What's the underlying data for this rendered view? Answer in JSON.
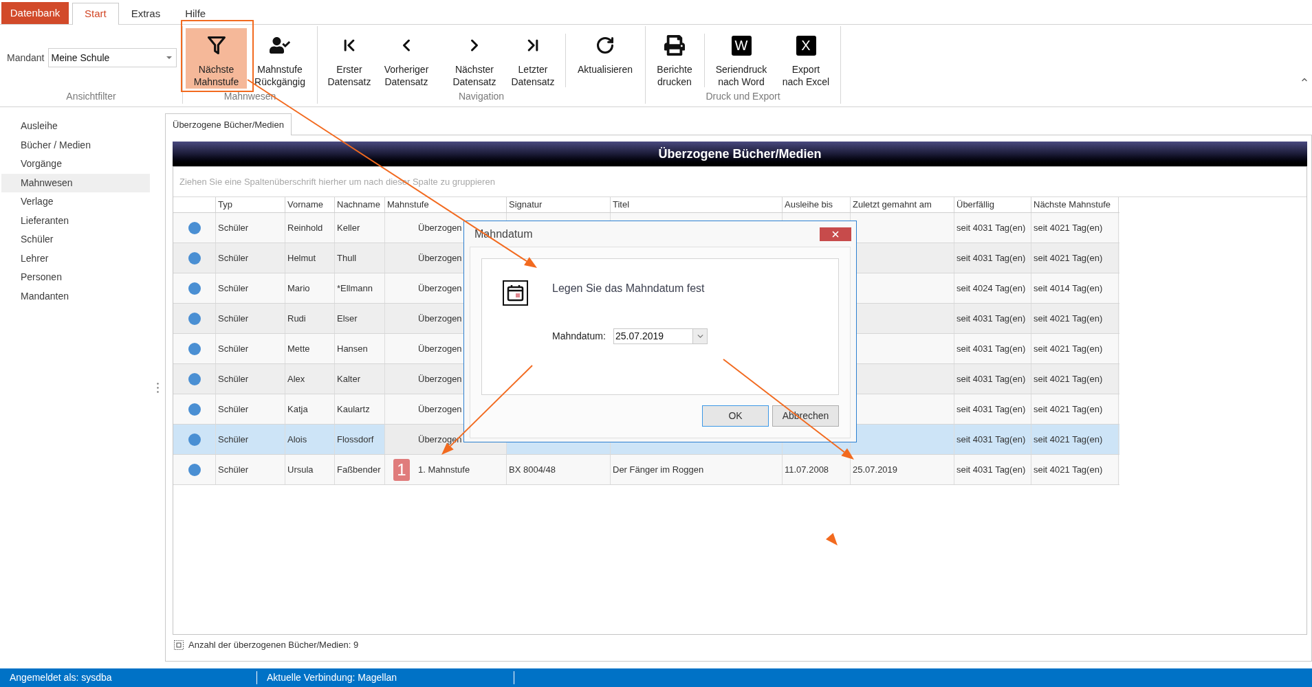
{
  "app_menu": {
    "label": "Datenbank"
  },
  "ribbon_tabs": [
    {
      "label": "Start",
      "selected": true
    },
    {
      "label": "Extras",
      "selected": false
    },
    {
      "label": "Hilfe",
      "selected": false
    }
  ],
  "ribbon_groups": [
    {
      "label": "Ansichtfilter",
      "kind": "field",
      "field": {
        "label": "Mandant",
        "value": "Meine Schule"
      }
    },
    {
      "label": "Mahnwesen",
      "kind": "buttons",
      "sections": [
        [
          {
            "lines": [
              "Nächste",
              "Mahnstufe"
            ],
            "highlighted": true
          },
          {
            "lines": [
              "Mahnstufe",
              "Rückgängig"
            ],
            "highlighted": false
          }
        ]
      ]
    },
    {
      "label": "Navigation",
      "kind": "buttons",
      "sections": [
        [
          {
            "lines": [
              "Erster",
              "Datensatz"
            ],
            "highlighted": false
          },
          {
            "lines": [
              "Vorheriger",
              "Datensatz"
            ],
            "highlighted": false
          },
          {
            "lines": [
              "Nächster",
              "Datensatz"
            ],
            "highlighted": false
          },
          {
            "lines": [
              "Letzter",
              "Datensatz"
            ],
            "highlighted": false
          }
        ],
        [
          {
            "lines": [
              "Aktualisieren"
            ],
            "highlighted": false
          }
        ]
      ]
    },
    {
      "label": "Druck und Export",
      "kind": "buttons",
      "sections": [
        [
          {
            "lines": [
              "Berichte",
              "drucken"
            ],
            "highlighted": false
          }
        ],
        [
          {
            "lines": [
              "Seriendruck",
              "nach Word"
            ],
            "highlighted": false,
            "icon_text": "W"
          },
          {
            "lines": [
              "Export",
              "nach Excel"
            ],
            "highlighted": false,
            "icon_text": "X"
          }
        ]
      ]
    }
  ],
  "sidebar": {
    "items": [
      {
        "label": "Ausleihe",
        "selected": false
      },
      {
        "label": "Bücher / Medien",
        "selected": false
      },
      {
        "label": "Vorgänge",
        "selected": false
      },
      {
        "label": "Mahnwesen",
        "selected": true
      },
      {
        "label": "Verlage",
        "selected": false
      },
      {
        "label": "Lieferanten",
        "selected": false
      },
      {
        "label": "Schüler",
        "selected": false
      },
      {
        "label": "Lehrer",
        "selected": false
      },
      {
        "label": "Personen",
        "selected": false
      },
      {
        "label": "Mandanten",
        "selected": false
      }
    ]
  },
  "content_tabs": [
    {
      "label": "Überzogene Bücher/Medien",
      "selected": true
    }
  ],
  "grid": {
    "title": "Überzogene Bücher/Medien",
    "group_hint": "Ziehen Sie eine Spaltenüberschrift hierher um nach dieser Spalte zu gruppieren",
    "columns": [
      "Typ",
      "Vorname",
      "Nachname",
      "Mahnstufe",
      "Signatur",
      "Titel",
      "Ausleihe bis",
      "Zuletzt gemahnt am",
      "Überfällig",
      "Nächste Mahnstufe"
    ],
    "rows": [
      {
        "selected": false,
        "typ": "Schüler",
        "vorname": "Reinhold",
        "nachname": "Keller",
        "mahnstufe": "Überzogen",
        "ueberfaellig": "seit 4031 Tag(en)",
        "naechste_mahnstufe": "seit 4021 Tag(en)"
      },
      {
        "selected": false,
        "typ": "Schüler",
        "vorname": "Helmut",
        "nachname": "Thull",
        "mahnstufe": "Überzogen",
        "ueberfaellig": "seit 4031 Tag(en)",
        "naechste_mahnstufe": "seit 4021 Tag(en)"
      },
      {
        "selected": false,
        "typ": "Schüler",
        "vorname": "Mario",
        "nachname": "*Ellmann",
        "mahnstufe": "Überzogen",
        "ueberfaellig": "seit 4024 Tag(en)",
        "naechste_mahnstufe": "seit 4014 Tag(en)"
      },
      {
        "selected": false,
        "typ": "Schüler",
        "vorname": "Rudi",
        "nachname": "Elser",
        "mahnstufe": "Überzogen",
        "ueberfaellig": "seit 4031 Tag(en)",
        "naechste_mahnstufe": "seit 4021 Tag(en)"
      },
      {
        "selected": false,
        "typ": "Schüler",
        "vorname": "Mette",
        "nachname": "Hansen",
        "mahnstufe": "Überzogen",
        "ueberfaellig": "seit 4031 Tag(en)",
        "naechste_mahnstufe": "seit 4021 Tag(en)"
      },
      {
        "selected": false,
        "typ": "Schüler",
        "vorname": "Alex",
        "nachname": "Kalter",
        "mahnstufe": "Überzogen",
        "ueberfaellig": "seit 4031 Tag(en)",
        "naechste_mahnstufe": "seit 4021 Tag(en)"
      },
      {
        "selected": false,
        "typ": "Schüler",
        "vorname": "Katja",
        "nachname": "Kaulartz",
        "mahnstufe": "Überzogen",
        "ueberfaellig": "seit 4031 Tag(en)",
        "naechste_mahnstufe": "seit 4021 Tag(en)"
      },
      {
        "selected": true,
        "typ": "Schüler",
        "vorname": "Alois",
        "nachname": "Flossdorf",
        "mahnstufe": "Überzogen",
        "ueberfaellig": "seit 4031 Tag(en)",
        "naechste_mahnstufe": "seit 4021 Tag(en)"
      },
      {
        "selected": false,
        "typ": "Schüler",
        "vorname": "Ursula",
        "nachname": "Faßbender",
        "mahnstufe_badge": "1",
        "mahnstufe": "1. Mahnstufe",
        "signatur": "BX 8004/48",
        "titel": "Der Fänger im Roggen",
        "ausleihe_bis": "11.07.2008",
        "zuletzt_gemahnt_am": "25.07.2019",
        "ueberfaellig": "seit 4031 Tag(en)",
        "naechste_mahnstufe": "seit 4021 Tag(en)"
      }
    ]
  },
  "record_count": "Anzahl der überzogenen Bücher/Medien: 9",
  "dialog": {
    "title": "Mahndatum",
    "message": "Legen Sie das Mahndatum fest",
    "date_field": {
      "label": "Mahndatum:",
      "value": "25.07.2019"
    },
    "buttons": [
      {
        "label": "OK",
        "focused": true
      },
      {
        "label": "Abbrechen",
        "focused": false
      }
    ]
  },
  "status_bar": [
    "Angemeldet als: sysdba",
    "Aktuelle Verbindung: Magellan"
  ]
}
